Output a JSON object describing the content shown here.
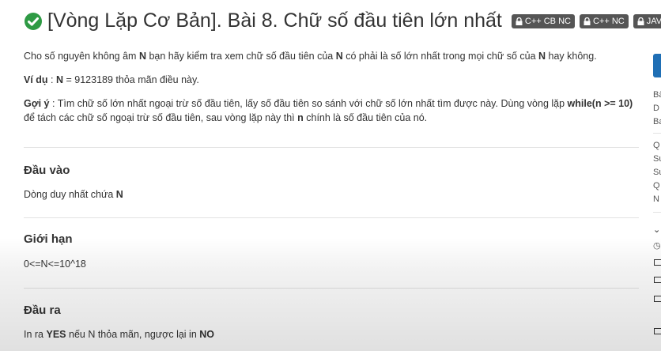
{
  "title": "[Vòng Lặp Cơ Bản]. Bài 8. Chữ số đầu tiên lớn nhất",
  "tags": [
    "C++ CB NC",
    "C++ NC",
    "JAVA"
  ],
  "statement": {
    "line1_a": "Cho số nguyên không âm ",
    "line1_n1": "N",
    "line1_b": " bạn hãy kiểm tra xem chữ số đầu tiên của ",
    "line1_n2": "N",
    "line1_c": " có phải là số lớn nhất trong mọi chữ số của ",
    "line1_n3": "N",
    "line1_d": " hay không.",
    "example_label": "Ví dụ",
    "example_colon": " : ",
    "example_n": "N",
    "example_text": " = 9123189 thỏa mãn điều này.",
    "hint_label": "Gợi ý",
    "hint_a": " : Tìm chữ số lớn nhất ngoại trừ số đầu tiên, lấy số đầu tiên so sánh với chữ số lớn nhất tìm được này. Dùng vòng lặp ",
    "hint_code": "while(n >= 10)",
    "hint_b": " để tách các chữ số ngoại trừ số đầu tiên, sau vòng lặp này thì ",
    "hint_n": "n",
    "hint_c": " chính là số đầu tiên của nó."
  },
  "input_section": {
    "heading": "Đầu vào",
    "text": "Dòng duy nhất chứa ",
    "n": "N"
  },
  "limit_section": {
    "heading": "Giới hạn",
    "text": "0<=N<=10^18"
  },
  "output_section": {
    "heading": "Đầu ra",
    "a": "In ra ",
    "yes": "YES",
    "b": " nếu N thỏa mãn, ngược lại in ",
    "no": "NO"
  },
  "sidebar": {
    "letters": [
      "Bà",
      "D",
      "Ba",
      "Q",
      "Su",
      "Su",
      "Q",
      "N"
    ]
  },
  "colors": {
    "check": "#2e9a44",
    "tag_bg": "#555555",
    "sidebar_button": "#1f6fb5"
  }
}
